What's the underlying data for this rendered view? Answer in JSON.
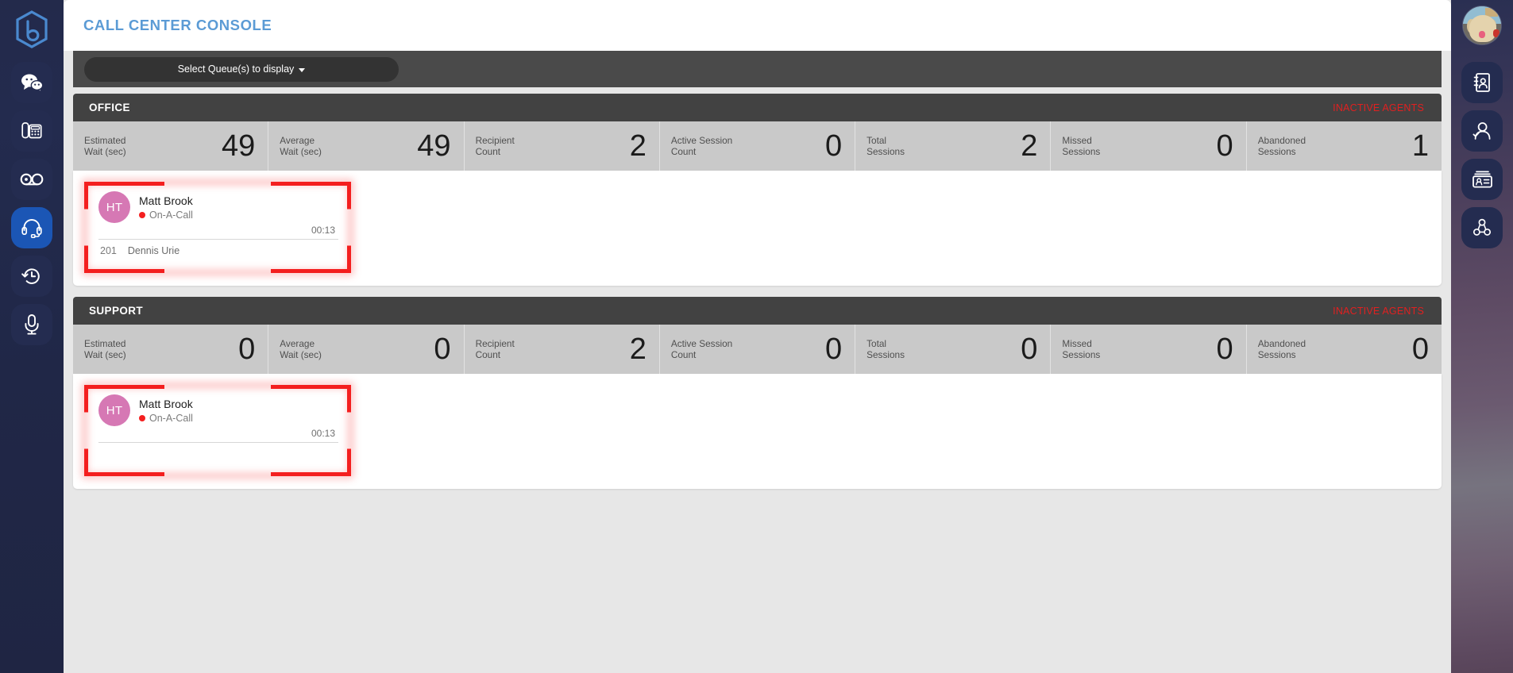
{
  "app": {
    "title": "CALL CENTER CONSOLE",
    "accent_color": "#5b9bd5",
    "alert_color": "#e02020"
  },
  "left_rail": {
    "logo_name": "brand-hexagon-logo",
    "items": [
      {
        "icon": "chat-bubbles-icon",
        "active": false
      },
      {
        "icon": "desk-phone-icon",
        "active": false
      },
      {
        "icon": "voicemail-icon",
        "active": false
      },
      {
        "icon": "headset-icon",
        "active": true
      },
      {
        "icon": "call-history-clock-icon",
        "active": false
      },
      {
        "icon": "microphone-icon",
        "active": false
      }
    ]
  },
  "right_rail": {
    "avatar_name": "user-avatar-photo",
    "items": [
      {
        "icon": "address-book-icon"
      },
      {
        "icon": "user-check-icon"
      },
      {
        "icon": "contact-card-icon"
      },
      {
        "icon": "team-network-icon"
      }
    ]
  },
  "selector": {
    "label": "Select Queue(s) to display",
    "caret": "caret-down-icon"
  },
  "queues": [
    {
      "name": "OFFICE",
      "inactive_agents_label": "INACTIVE AGENTS",
      "stats": [
        {
          "label_line1": "Estimated",
          "label_line2": "Wait (sec)",
          "value": "49"
        },
        {
          "label_line1": "Average",
          "label_line2": "Wait (sec)",
          "value": "49"
        },
        {
          "label_line1": "Recipient",
          "label_line2": "Count",
          "value": "2"
        },
        {
          "label_line1": "Active Session",
          "label_line2": "Count",
          "value": "0"
        },
        {
          "label_line1": "Total",
          "label_line2": "Sessions",
          "value": "2"
        },
        {
          "label_line1": "Missed",
          "label_line2": "Sessions",
          "value": "0"
        },
        {
          "label_line1": "Abandoned",
          "label_line2": "Sessions",
          "value": "1"
        }
      ],
      "agents": [
        {
          "initials": "HT",
          "name": "Matt Brook",
          "status": "On-A-Call",
          "status_color": "#f41f1f",
          "timer": "00:13",
          "caller_ext": "201",
          "caller_name": "Dennis Urie"
        }
      ]
    },
    {
      "name": "SUPPORT",
      "inactive_agents_label": "INACTIVE AGENTS",
      "stats": [
        {
          "label_line1": "Estimated",
          "label_line2": "Wait (sec)",
          "value": "0"
        },
        {
          "label_line1": "Average",
          "label_line2": "Wait (sec)",
          "value": "0"
        },
        {
          "label_line1": "Recipient",
          "label_line2": "Count",
          "value": "2"
        },
        {
          "label_line1": "Active Session",
          "label_line2": "Count",
          "value": "0"
        },
        {
          "label_line1": "Total",
          "label_line2": "Sessions",
          "value": "0"
        },
        {
          "label_line1": "Missed",
          "label_line2": "Sessions",
          "value": "0"
        },
        {
          "label_line1": "Abandoned",
          "label_line2": "Sessions",
          "value": "0"
        }
      ],
      "agents": [
        {
          "initials": "HT",
          "name": "Matt Brook",
          "status": "On-A-Call",
          "status_color": "#f41f1f",
          "timer": "00:13",
          "caller_ext": "",
          "caller_name": ""
        }
      ]
    }
  ]
}
